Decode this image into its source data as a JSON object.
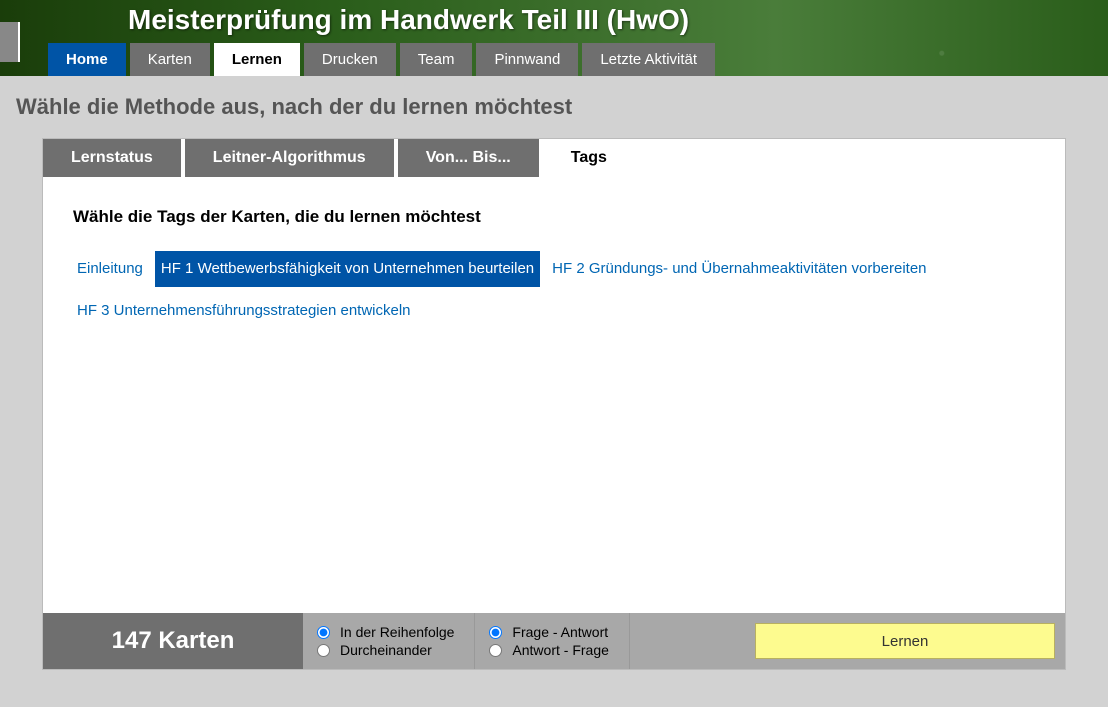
{
  "header": {
    "title": "Meisterprüfung im Handwerk Teil III (HwO)",
    "nav": [
      {
        "label": "Home",
        "class": "home"
      },
      {
        "label": "Karten",
        "class": ""
      },
      {
        "label": "Lernen",
        "class": "active"
      },
      {
        "label": "Drucken",
        "class": ""
      },
      {
        "label": "Team",
        "class": ""
      },
      {
        "label": "Pinnwand",
        "class": ""
      },
      {
        "label": "Letzte Aktivität",
        "class": ""
      }
    ]
  },
  "subheader": "Wähle die Methode aus, nach der du lernen möchtest",
  "tabs": [
    {
      "label": "Lernstatus",
      "active": false
    },
    {
      "label": "Leitner-Algorithmus",
      "active": false
    },
    {
      "label": "Von... Bis...",
      "active": false
    },
    {
      "label": "Tags",
      "active": true
    }
  ],
  "content": {
    "instruction": "Wähle die Tags der Karten, die du lernen möchtest",
    "tags": [
      {
        "label": "Einleitung",
        "selected": false
      },
      {
        "label": "HF 1 Wettbewerbsfähigkeit von Unternehmen beurteilen",
        "selected": true
      },
      {
        "label": "HF 2 Gründungs- und Übernahmeaktivitäten vorbereiten",
        "selected": false
      },
      {
        "label": "HF 3 Unternehmensführungsstrategien entwickeln",
        "selected": false
      }
    ]
  },
  "footer": {
    "count": "147 Karten",
    "order_group": [
      {
        "label": "In der Reihenfolge",
        "checked": true,
        "name": "order"
      },
      {
        "label": "Durcheinander",
        "checked": false,
        "name": "order"
      }
    ],
    "direction_group": [
      {
        "label": "Frage - Antwort",
        "checked": true,
        "name": "dir"
      },
      {
        "label": "Antwort - Frage",
        "checked": false,
        "name": "dir"
      }
    ],
    "learn_button": "Lernen"
  }
}
